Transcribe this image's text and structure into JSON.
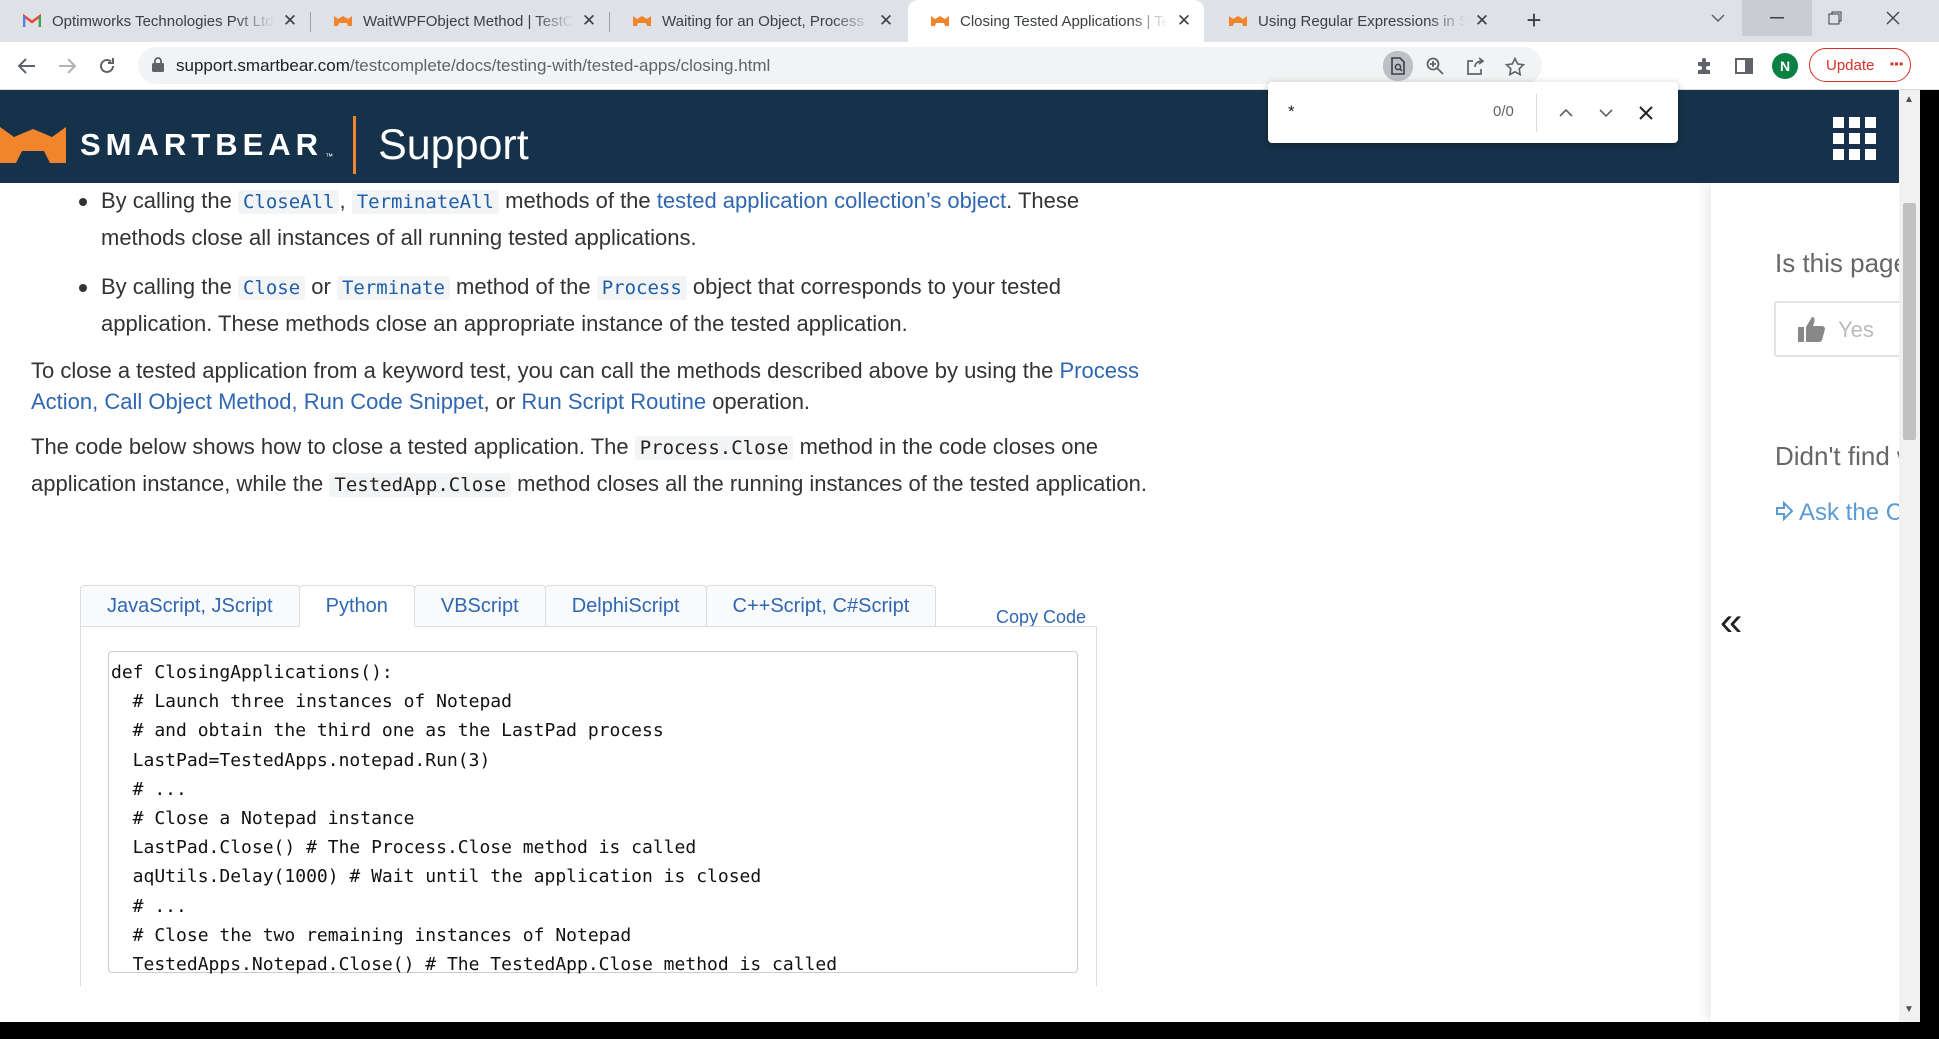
{
  "browser": {
    "tabs": [
      {
        "title": "Optimworks Technologies Pvt Ltd",
        "favicon": "gmail-icon"
      },
      {
        "title": "WaitWPFObject Method | TestComplete",
        "favicon": "smartbear-icon"
      },
      {
        "title": "Waiting for an Object, Process or Window",
        "favicon": "smartbear-icon"
      },
      {
        "title": "Closing Tested Applications | TestComplete",
        "favicon": "smartbear-icon",
        "active": true
      },
      {
        "title": "Using Regular Expressions in Scripts",
        "favicon": "smartbear-icon"
      }
    ],
    "url_host": "support.smartbear.com",
    "url_path": "/testcomplete/docs/testing-with/tested-apps/closing.html",
    "profile_initial": "N",
    "update_label": "Update",
    "find": {
      "query": "*",
      "count": "0/0"
    }
  },
  "header": {
    "brand": "SMARTBEAR",
    "trademark": "™",
    "section": "Support"
  },
  "content": {
    "clipped_line": "…",
    "bullet1": {
      "pre": "By calling the ",
      "code1": "CloseAll",
      "sep": ", ",
      "code2": "TerminateAll",
      "mid": " methods of the ",
      "link": "tested application collection’s object",
      "post": ". These methods close all instances of all running tested applications."
    },
    "bullet2": {
      "pre": "By calling the ",
      "code1": "Close",
      "or": " or ",
      "code2": "Terminate",
      "mid": " method of the ",
      "code3": "Process",
      "post": " object that corresponds to your tested application. These methods close an appropriate instance of the tested application."
    },
    "para1": {
      "pre": "To close a tested application from a keyword test, you can call the methods described above by using the ",
      "link1": "Process Action",
      "c1": ", ",
      "link2": "Call Object Method",
      "c2": ", ",
      "link3": "Run Code Snippet",
      "c3": ", or ",
      "link4": "Run Script Routine",
      "post": " operation."
    },
    "para2": {
      "pre": "The code below shows how to close a tested application. The ",
      "code1": "Process.Close",
      "mid": " method in the code closes one application instance, while the ",
      "code2": "TestedApp.Close",
      "post": " method closes all the running instances of the tested application."
    },
    "code_tabs": [
      "JavaScript, JScript",
      "Python",
      "VBScript",
      "DelphiScript",
      "C++Script, C#Script"
    ],
    "selected_tab": "Python",
    "copy_label": "Copy Code",
    "code_lines": [
      "def ClosingApplications():",
      "  # Launch three instances of Notepad",
      "  # and obtain the third one as the LastPad process",
      "  LastPad=TestedApps.notepad.Run(3)",
      "  # ...",
      "  # Close a Notepad instance",
      "  LastPad.Close() # The Process.Close method is called",
      "  aqUtils.Delay(1000) # Wait until the application is closed",
      "  # ...",
      "  # Close the two remaining instances of Notepad",
      "  TestedApps.Notepad.Close() # The TestedApp.Close method is called"
    ]
  },
  "rail": {
    "feedback_question": "Is this page helpful?",
    "yes_label": "Yes",
    "not_found": "Didn't find what you were looking for?",
    "ask_label": "Ask the Community",
    "collapse_glyph": "«"
  },
  "colors": {
    "header_bg": "#16324a",
    "accent_orange": "#f2852c",
    "link_blue": "#2f67b2"
  }
}
